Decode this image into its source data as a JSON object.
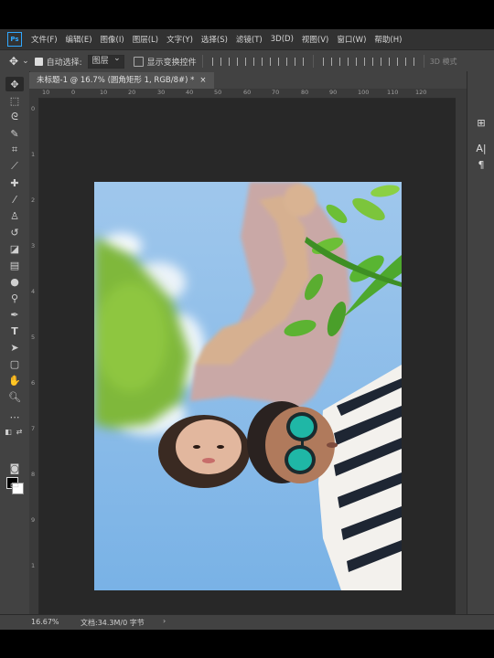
{
  "menubar": {
    "logo": "Ps",
    "items": [
      "文件(F)",
      "编辑(E)",
      "图像(I)",
      "图层(L)",
      "文字(Y)",
      "选择(S)",
      "滤镜(T)",
      "3D(D)",
      "视图(V)",
      "窗口(W)",
      "帮助(H)"
    ]
  },
  "options": {
    "auto_select_label": "自动选择:",
    "auto_select_value": "图层",
    "show_transform_label": "显示变换控件",
    "mode_3d_label": "3D 模式"
  },
  "document_tab": {
    "title": "未标题-1 @ 16.7% (圆角矩形 1, RGB/8#) *",
    "close": "×"
  },
  "ruler_top_labels": [
    "10",
    "0",
    "10",
    "20",
    "30",
    "40",
    "50",
    "60",
    "70",
    "80",
    "90",
    "100",
    "110",
    "120"
  ],
  "ruler_left_labels": [
    "0",
    "1",
    "2",
    "3",
    "4",
    "5",
    "6",
    "7",
    "8",
    "9",
    "1"
  ],
  "status": {
    "zoom": "16.67%",
    "doc_info": "文档:34.3M/0 字节",
    "arrow": "›"
  },
  "toolbar_icons": [
    "move-tool",
    "marquee-tool",
    "lasso-tool",
    "quick-select-tool",
    "crop-tool",
    "eyedropper-tool",
    "healing-tool",
    "brush-tool",
    "stamp-tool",
    "history-brush-tool",
    "eraser-tool",
    "gradient-tool",
    "blur-tool",
    "dodge-tool",
    "pen-tool",
    "type-tool",
    "path-select-tool",
    "shape-tool",
    "hand-tool",
    "zoom-tool",
    "more-tools"
  ],
  "right_panel_icons": [
    "properties-icon",
    "character-icon",
    "paragraph-icon"
  ]
}
